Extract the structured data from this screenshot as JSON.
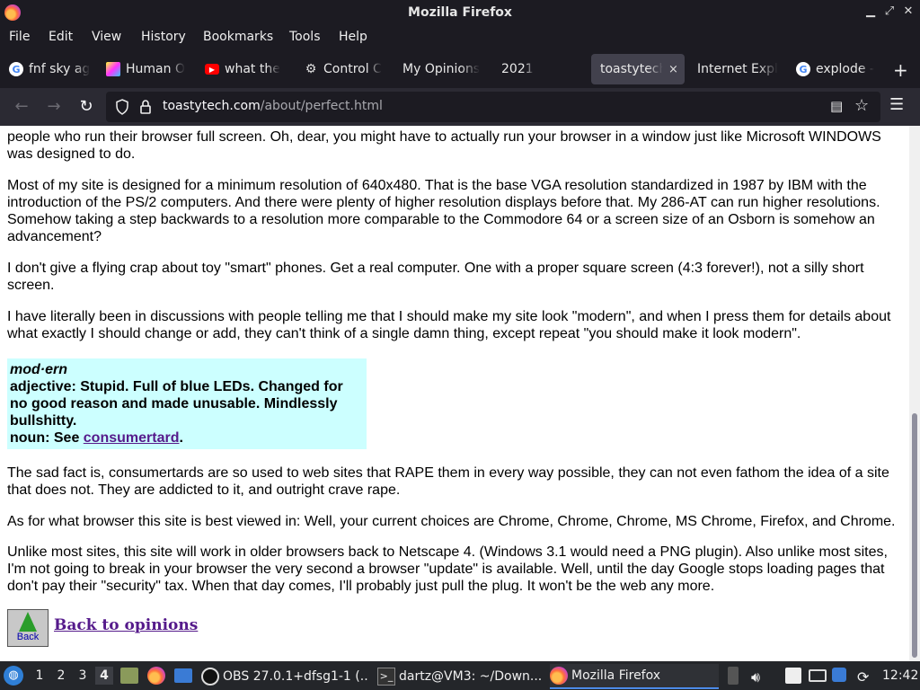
{
  "window": {
    "title": "Mozilla Firefox"
  },
  "menubar": [
    "File",
    "Edit",
    "View",
    "History",
    "Bookmarks",
    "Tools",
    "Help"
  ],
  "tabs": [
    {
      "label": "fnf sky ag",
      "icon": "google-icon"
    },
    {
      "label": "Human O",
      "icon": "colorful-icon"
    },
    {
      "label": "what the",
      "icon": "youtube-icon"
    },
    {
      "label": "Control C",
      "icon": "gear-icon"
    },
    {
      "label": "My Opinions",
      "icon": ""
    },
    {
      "label": "2021",
      "icon": ""
    },
    {
      "label": "toastytech",
      "icon": "",
      "active": true,
      "close": "×"
    },
    {
      "label": "Internet Expl",
      "icon": ""
    },
    {
      "label": "explode -",
      "icon": "google-icon"
    }
  ],
  "url": {
    "domain": "toastytech.com",
    "path": "/about/perfect.html"
  },
  "content": {
    "p1": "people who run their browser full screen. Oh, dear, you might have to actually run your browser in a window just like Microsoft WINDOWS was designed to do.",
    "p2": "Most of my site is designed for a minimum resolution of 640x480. That is the base VGA resolution standardized in 1987 by IBM with the introduction of the PS/2 computers. And there were plenty of higher resolution displays before that. My 286-AT can run higher resolutions. Somehow taking a step backwards to a resolution more comparable to the Commodore 64 or a screen size of an Osborn is somehow an advancement?",
    "p3": "I don't give a flying crap about toy \"smart\" phones. Get a real computer. One with a proper square screen (4:3 forever!), not a silly short screen.",
    "p4": "I have literally been in discussions with people telling me that I should make my site look \"modern\", and when I press them for details about what exactly I should change or add, they can't think of a single damn thing, except repeat \"you should make it look modern\".",
    "definition": {
      "word": "mod·ern",
      "adjective": "adjective: Stupid. Full of blue LEDs. Changed for no good reason and made unusable. Mindlessly bullshitty.",
      "noun_prefix": "noun: See ",
      "noun_link": "consumertard",
      "noun_suffix": "."
    },
    "p5": "The sad fact is, consumertards are so used to web sites that RAPE them in every way possible, they can not even fathom the idea of a site that does not. They are addicted to it, and outright crave rape.",
    "p6": "As for what browser this site is best viewed in: Well, your current choices are Chrome, Chrome, Chrome, MS Chrome, Firefox, and Chrome.",
    "p7": "Unlike most sites, this site will work in older browsers back to Netscape 4. (Windows 3.1 would need a PNG plugin). Also unlike most sites, I'm not going to break in your browser the very second a browser \"update\" is available. Well, until the day Google stops loading pages that don't pay their \"security\" tax. When that day comes, I'll probably just pull the plug. It won't be the web any more.",
    "back_button_label": "Back",
    "back_link": "Back to opinions"
  },
  "taskbar": {
    "workspaces": [
      "1",
      "2",
      "3",
      "4"
    ],
    "active_workspace": "4",
    "tasks": [
      {
        "label": "OBS 27.0.1+dfsg1-1 (...",
        "icon": "obs-icon"
      },
      {
        "label": "dartz@VM3: ~/Down...",
        "icon": "terminal-icon"
      },
      {
        "label": "Mozilla Firefox",
        "icon": "firefox-icon",
        "active": true
      }
    ],
    "clock": "12:42"
  },
  "colors": {
    "definition_bg": "#ccffff",
    "visited_link": "#551a8b",
    "chrome_dark": "#1c1b22"
  }
}
